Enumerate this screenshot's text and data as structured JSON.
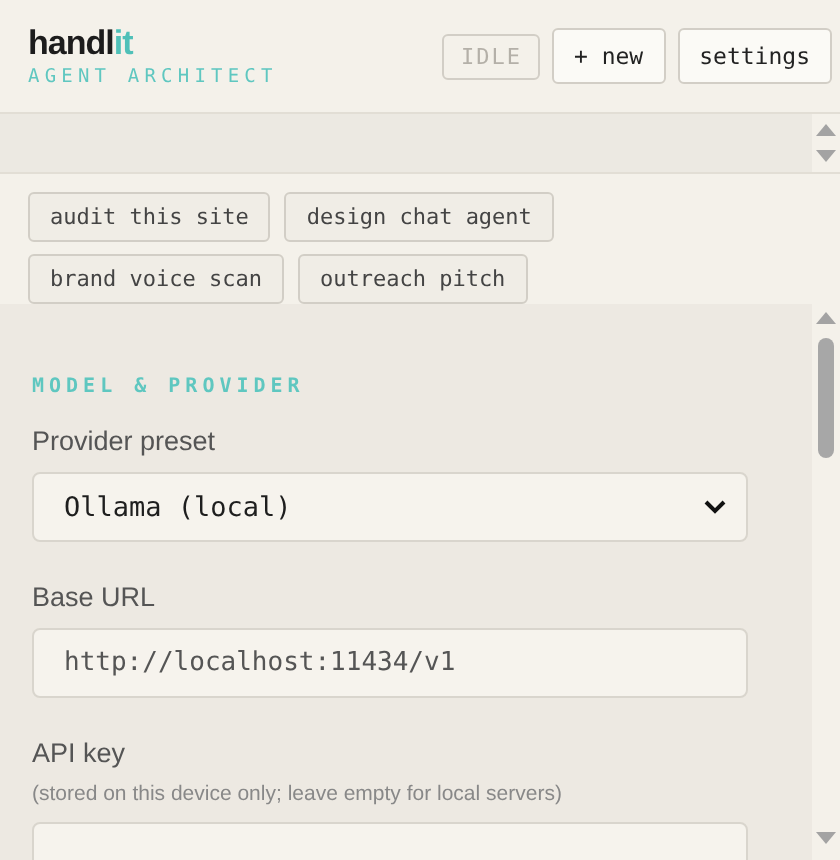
{
  "header": {
    "logo": {
      "main": "handl",
      "accent": "it"
    },
    "subtitle": "AGENT ARCHITECT",
    "status": "IDLE",
    "buttons": [
      "+ new",
      "settings"
    ]
  },
  "suggestions": [
    {
      "label": "audit this site"
    },
    {
      "label": "design chat agent"
    },
    {
      "label": "brand voice scan"
    },
    {
      "label": "outreach pitch"
    }
  ],
  "settings": {
    "section_title": "MODEL & PROVIDER",
    "fields": [
      {
        "kind": "select",
        "label": "Provider preset",
        "value": "Ollama (local)"
      },
      {
        "kind": "text",
        "label": "Base URL",
        "value": "http://localhost:11434/v1"
      },
      {
        "kind": "text",
        "label": "API key",
        "hint": "(stored on this device only; leave empty for local servers)"
      }
    ]
  }
}
